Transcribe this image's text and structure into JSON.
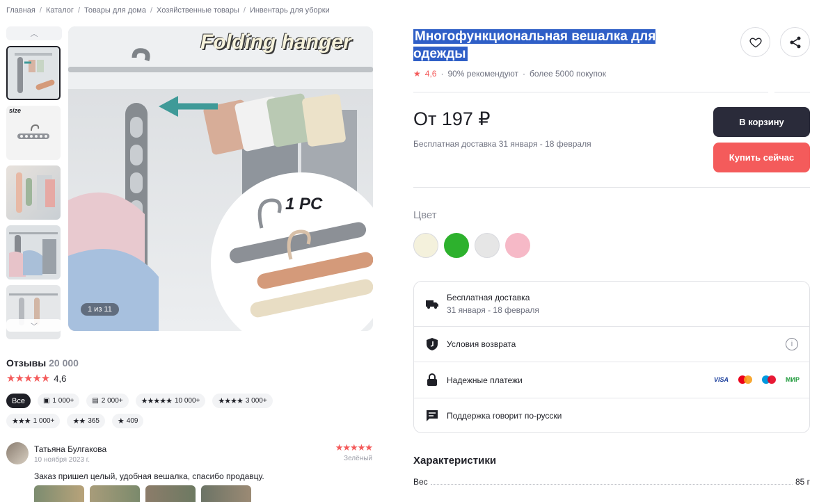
{
  "breadcrumb": [
    "Главная",
    "Каталог",
    "Товары для дома",
    "Хозяйственные товары",
    "Инвентарь для уборки"
  ],
  "gallery": {
    "counter": "1 из 11",
    "banner_text": "Folding hanger",
    "pc_text": "1 PC",
    "thumb2_text": "size"
  },
  "reviews": {
    "title": "Отзывы",
    "count": "20 000",
    "rating": "4,6",
    "filters": [
      {
        "label": "Все",
        "icon": ""
      },
      {
        "label": "1 000+",
        "icon": "photo-icon"
      },
      {
        "label": "2 000+",
        "icon": "comment-icon"
      },
      {
        "label": "10 000+",
        "icon": "stars-5-icon"
      },
      {
        "label": "3 000+",
        "icon": "stars-4-icon"
      },
      {
        "label": "1 000+",
        "icon": "stars-3-icon"
      },
      {
        "label": "365",
        "icon": "stars-2-icon"
      },
      {
        "label": "409",
        "icon": "stars-1-icon"
      }
    ],
    "item": {
      "name": "Татьяна Булгакова",
      "date": "10 ноября 2023 г.",
      "color": "Зелёный",
      "text": "Заказ пришел целый, удобная вешалка, спасибо продавцу.",
      "rating": 5
    }
  },
  "product": {
    "title": "Многофункциональная вешалка для одежды",
    "rating": "4,6",
    "recommend": "90% рекомендуют",
    "purchases": "более 5000 покупок",
    "price": "От 197 ₽",
    "delivery": "Бесплатная доставка 31 января - 18 февраля",
    "cart_button": "В корзину",
    "buy_button": "Купить сейчас",
    "color_label": "Цвет",
    "colors": [
      "#f4f1dc",
      "#2db12d",
      "#e6e6e6",
      "#f6b9c7"
    ]
  },
  "info": {
    "delivery_title": "Бесплатная доставка",
    "delivery_dates": "31 января - 18 февраля",
    "returns": "Условия возврата",
    "payments": "Надежные платежи",
    "support": "Поддержка говорит по-русски",
    "pay_methods": [
      "VISA",
      "MC",
      "Maestro",
      "МИР"
    ]
  },
  "characteristics": {
    "title": "Характеристики",
    "rows": [
      {
        "name": "Вес",
        "value": "85 г"
      }
    ]
  },
  "colors": {
    "accent": "#f45b5b",
    "dark": "#2a2b3a",
    "selection": "#2f5fc7"
  }
}
